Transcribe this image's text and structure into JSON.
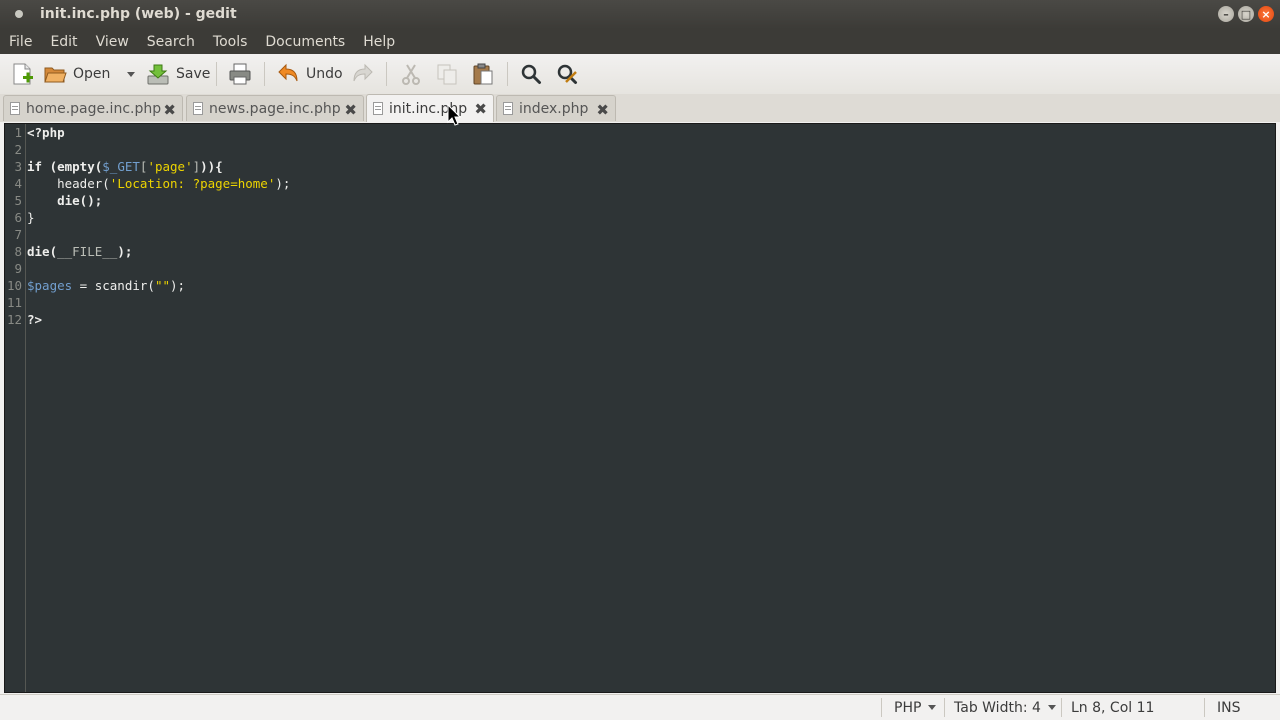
{
  "window": {
    "title": "init.inc.php (web) - gedit"
  },
  "menu": [
    "File",
    "Edit",
    "View",
    "Search",
    "Tools",
    "Documents",
    "Help"
  ],
  "toolbar": {
    "open_label": "Open",
    "save_label": "Save",
    "undo_label": "Undo"
  },
  "tabs": [
    {
      "label": "home.page.inc.php"
    },
    {
      "label": "news.page.inc.php"
    },
    {
      "label": "init.inc.php",
      "active": true
    },
    {
      "label": "index.php"
    }
  ],
  "editor": {
    "lines": [
      {
        "n": "1",
        "parts": [
          [
            "kw",
            "<?php"
          ]
        ]
      },
      {
        "n": "2",
        "parts": []
      },
      {
        "n": "3",
        "parts": [
          [
            "kw",
            "if (empty("
          ],
          [
            "var",
            "$_GET"
          ],
          [
            "dim",
            "["
          ],
          [
            "str",
            "'page'"
          ],
          [
            "dim",
            "]"
          ],
          [
            "kw",
            ")){"
          ]
        ]
      },
      {
        "n": "4",
        "parts": [
          [
            "plain",
            "    header("
          ],
          [
            "str",
            "'Location: ?page=home'"
          ],
          [
            "plain",
            ");"
          ]
        ]
      },
      {
        "n": "5",
        "parts": [
          [
            "kw",
            "    die();"
          ]
        ]
      },
      {
        "n": "6",
        "parts": [
          [
            "plain",
            "}"
          ]
        ]
      },
      {
        "n": "7",
        "parts": []
      },
      {
        "n": "8",
        "parts": [
          [
            "kw",
            "die("
          ],
          [
            "dim",
            "__FILE__"
          ],
          [
            "kw",
            ");"
          ]
        ]
      },
      {
        "n": "9",
        "parts": []
      },
      {
        "n": "10",
        "parts": [
          [
            "var",
            "$pages"
          ],
          [
            "plain",
            " = scandir("
          ],
          [
            "str",
            "\"\""
          ],
          [
            "plain",
            ");"
          ]
        ]
      },
      {
        "n": "11",
        "parts": []
      },
      {
        "n": "12",
        "parts": [
          [
            "kw",
            "?>"
          ]
        ]
      }
    ]
  },
  "status": {
    "language": "PHP",
    "tab_width": "Tab Width: 4",
    "position": "Ln 8, Col 11",
    "mode": "INS"
  }
}
